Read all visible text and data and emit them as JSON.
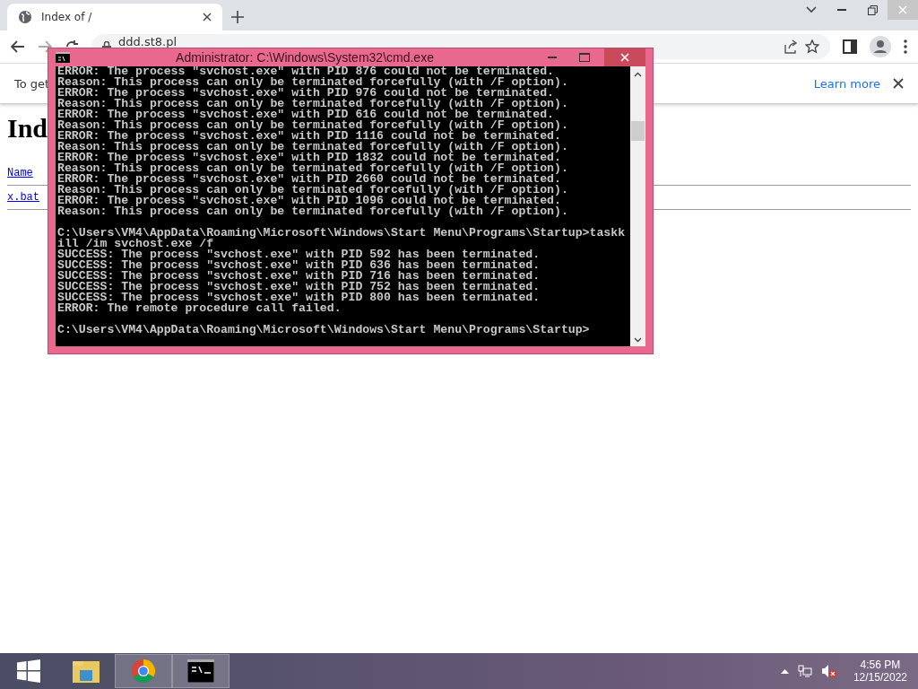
{
  "browser": {
    "tab": {
      "title": "Index of /",
      "selected": true
    },
    "address": "ddd.st8.pl",
    "infobar": {
      "text": "To get",
      "link": "Learn more"
    },
    "page": {
      "heading": "Ind",
      "column": "Name",
      "files": [
        "x.bat"
      ]
    }
  },
  "console": {
    "title": "Administrator: C:\\Windows\\System32\\cmd.exe",
    "blocks": [
      [
        "ERROR: The process \"svchost.exe\" with PID 876 could not be terminated.",
        "Reason: This process can only be terminated forcefully (with /F option).",
        "ERROR: The process \"svchost.exe\" with PID 976 could not be terminated.",
        "Reason: This process can only be terminated forcefully (with /F option).",
        "ERROR: The process \"svchost.exe\" with PID 616 could not be terminated.",
        "Reason: This process can only be terminated forcefully (with /F option).",
        "ERROR: The process \"svchost.exe\" with PID 1116 could not be terminated.",
        "Reason: This process can only be terminated forcefully (with /F option).",
        "ERROR: The process \"svchost.exe\" with PID 1832 could not be terminated.",
        "Reason: This process can only be terminated forcefully (with /F option).",
        "ERROR: The process \"svchost.exe\" with PID 2660 could not be terminated.",
        "Reason: This process can only be terminated forcefully (with /F option).",
        "ERROR: The process \"svchost.exe\" with PID 1096 could not be terminated.",
        "Reason: This process can only be terminated forcefully (with /F option)."
      ],
      [
        "C:\\Users\\VM4\\AppData\\Roaming\\Microsoft\\Windows\\Start Menu\\Programs\\Startup>taskk",
        "ill /im svchost.exe /f",
        "SUCCESS: The process \"svchost.exe\" with PID 592 has been terminated.",
        "SUCCESS: The process \"svchost.exe\" with PID 636 has been terminated.",
        "SUCCESS: The process \"svchost.exe\" with PID 716 has been terminated.",
        "SUCCESS: The process \"svchost.exe\" with PID 752 has been terminated.",
        "SUCCESS: The process \"svchost.exe\" with PID 800 has been terminated.",
        "ERROR: The remote procedure call failed."
      ],
      [
        "C:\\Users\\VM4\\AppData\\Roaming\\Microsoft\\Windows\\Start Menu\\Programs\\Startup>"
      ]
    ]
  },
  "taskbar": {
    "apps": [
      {
        "kind": "explorer",
        "selected": false
      },
      {
        "kind": "chrome",
        "selected": true
      },
      {
        "kind": "cmd",
        "selected": true
      }
    ],
    "time": "4:56 PM",
    "date": "12/15/2022"
  }
}
